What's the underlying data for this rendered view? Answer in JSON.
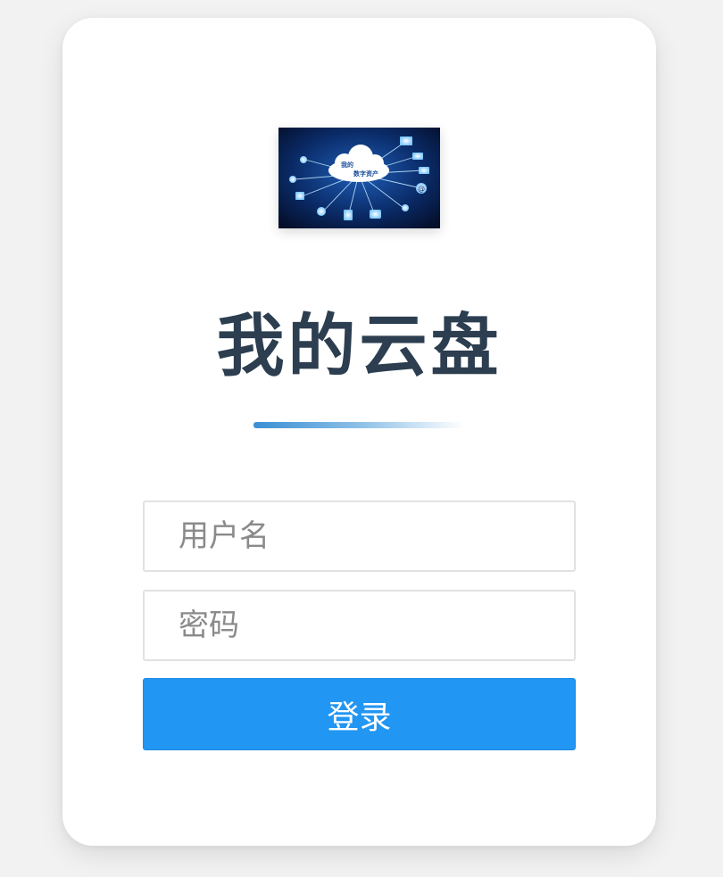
{
  "logo": {
    "line1": "我的",
    "line2": "数字资产"
  },
  "title": "我的云盘",
  "form": {
    "username_placeholder": "用户名",
    "password_placeholder": "密码",
    "login_label": "登录"
  },
  "colors": {
    "page_background": "#f2f2f2",
    "card_background": "#ffffff",
    "title_text": "#2c3e50",
    "accent": "#2196f3",
    "divider_start": "#3a8fd4"
  }
}
